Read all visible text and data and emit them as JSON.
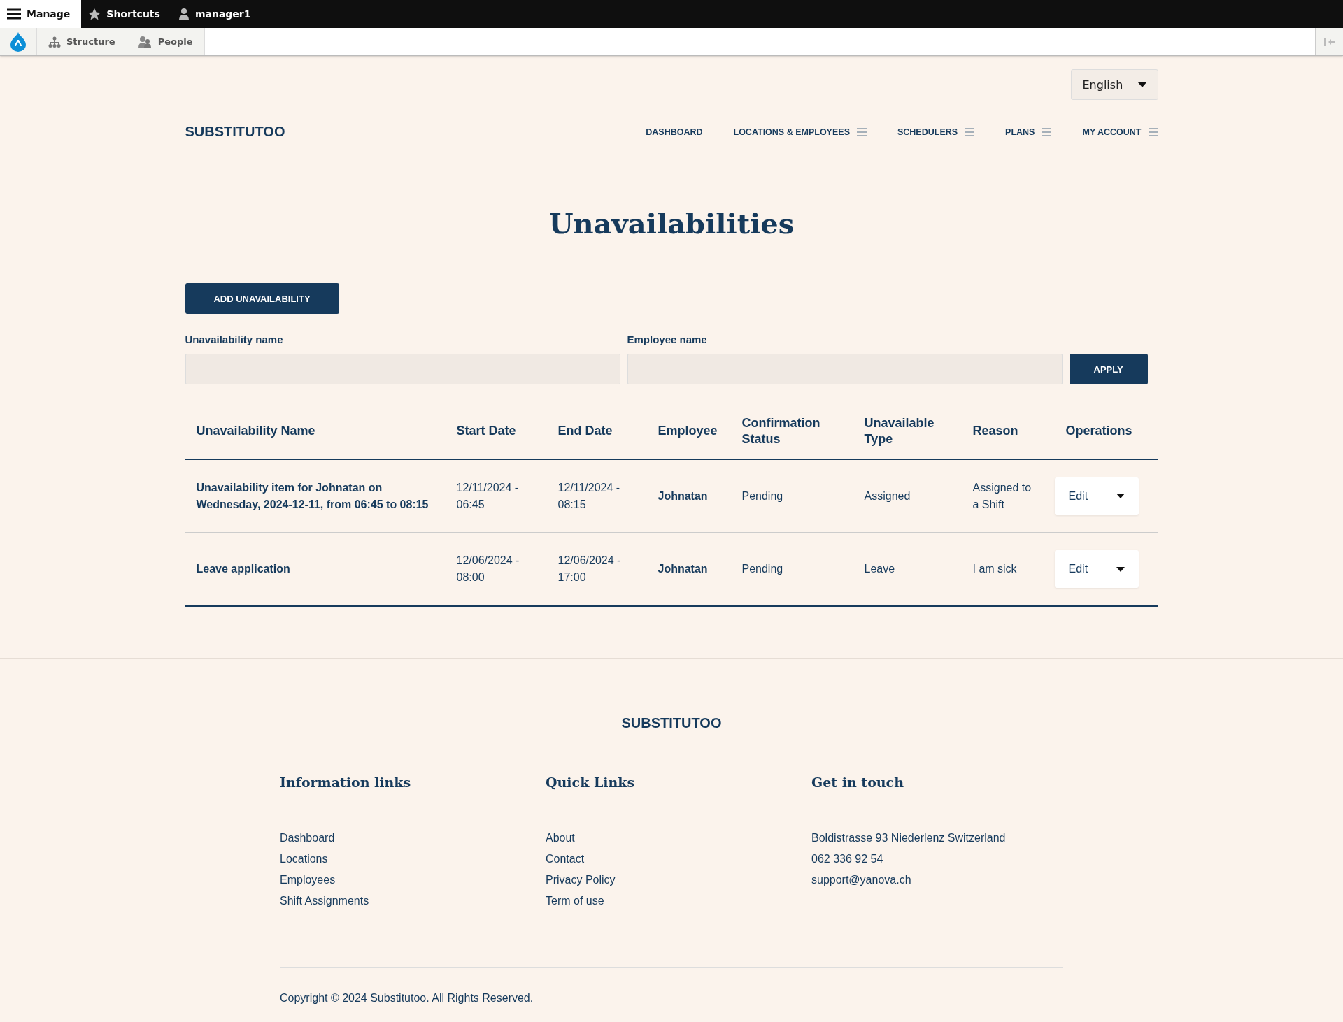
{
  "toolbar": {
    "manage": "Manage",
    "shortcuts": "Shortcuts",
    "user": "manager1"
  },
  "admin_menu": [
    {
      "kind": "structure",
      "label": "Structure"
    },
    {
      "kind": "people",
      "label": "People"
    }
  ],
  "language": "English",
  "brand": "SUBSTITUTOO",
  "nav": [
    {
      "label": "DASHBOARD",
      "has_menu": false
    },
    {
      "label": "LOCATIONS & EMPLOYEES",
      "has_menu": true
    },
    {
      "label": "SCHEDULERS",
      "has_menu": true
    },
    {
      "label": "PLANS",
      "has_menu": true
    },
    {
      "label": "MY ACCOUNT",
      "has_menu": true
    }
  ],
  "title": "Unavailabilities",
  "add_button": "ADD UNAVAILABILITY",
  "filters": [
    {
      "label": "Unavailability name"
    },
    {
      "label": "Employee name"
    }
  ],
  "apply_button": "APPLY",
  "table": {
    "columns": [
      "Unavailability Name",
      "Start Date",
      "End Date",
      "Employee",
      "Confirmation Status",
      "Unavailable Type",
      "Reason",
      "Operations"
    ],
    "rows": [
      {
        "name": "Unavailability item for Johnatan on Wednesday, 2024-12-11, from 06:45 to 08:15",
        "start": "12/11/2024 - 06:45",
        "end": "12/11/2024 - 08:15",
        "employee": "Johnatan",
        "status": "Pending",
        "type": "Assigned",
        "reason": "Assigned to a Shift",
        "operation": "Edit"
      },
      {
        "name": "Leave application",
        "start": "12/06/2024 - 08:00",
        "end": "12/06/2024 - 17:00",
        "employee": "Johnatan",
        "status": "Pending",
        "type": "Leave",
        "reason": "I am sick",
        "operation": "Edit"
      }
    ]
  },
  "footer": {
    "brand": "SUBSTITUTOO",
    "columns": [
      {
        "title": "Information links",
        "links": [
          "Dashboard",
          "Locations",
          "Employees",
          "Shift Assignments"
        ]
      },
      {
        "title": "Quick Links",
        "links": [
          "About",
          "Contact",
          "Privacy Policy",
          "Term of use"
        ]
      },
      {
        "title": "Get in touch",
        "links": [
          "Boldistrasse 93 Niederlenz Switzerland",
          "062 336 92 54",
          "support@yanova.ch"
        ]
      }
    ],
    "copyright": "Copyright © 2024 Substitutoo. All Rights Reserved."
  }
}
